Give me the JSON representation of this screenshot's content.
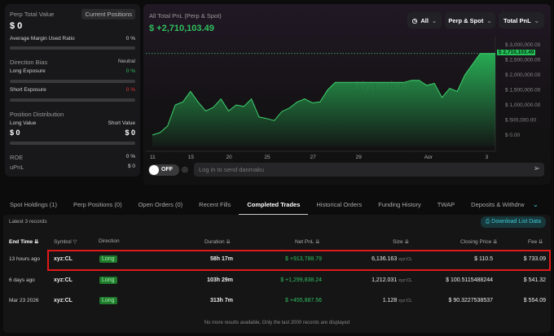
{
  "left": {
    "perp_total_value_label": "Perp Total Value",
    "current_positions_btn": "Current Positions",
    "perp_total_value": "$ 0",
    "margin_label": "Average Margin Used Ratio",
    "margin_value": "0 %",
    "margin_fill_pct": 0,
    "direction_bias_label": "Direction Bias",
    "direction_bias_value": "Neutral",
    "long_exposure_label": "Long Exposure",
    "long_exposure_value": "0 %",
    "short_exposure_label": "Short Exposure",
    "short_exposure_value": "0 %",
    "position_distribution_label": "Position Distribution",
    "long_value_label": "Long Value",
    "short_value_label": "Short Value",
    "long_value": "$ 0",
    "short_value": "$ 0",
    "roe_label": "ROE",
    "roe_value": "0 %",
    "upnl_label": "uPnL",
    "upnl_value": "$ 0"
  },
  "chart_header": {
    "title": "All Total PnL (Perp & Spot)",
    "value": "$ +2,710,103.49",
    "range": "All",
    "market": "Perp & Spot",
    "metric": "Total PnL",
    "watermark": "Hyperbot",
    "current_label": "$ 2,710,103.49"
  },
  "danmaku": {
    "toggle": "OFF",
    "placeholder": "Log in to send danmaku"
  },
  "chart_data": {
    "type": "area",
    "title": "All Total PnL (Perp & Spot)",
    "ylim": [
      -200000,
      3200000
    ],
    "yticks": [
      {
        "v": 3000000,
        "label": "$ 3,000,000.00"
      },
      {
        "v": 2500000,
        "label": "$ 2,500,000.00"
      },
      {
        "v": 2000000,
        "label": "$ 2,000,000.00"
      },
      {
        "v": 1500000,
        "label": "$ 1,500,000.00"
      },
      {
        "v": 1000000,
        "label": "$ 1,000,000.00"
      },
      {
        "v": 500000,
        "label": "$ 500,000.00"
      },
      {
        "v": 0,
        "label": "$ 0.00"
      }
    ],
    "xticks": [
      {
        "i": 0,
        "label": "11"
      },
      {
        "i": 5,
        "label": "15"
      },
      {
        "i": 10,
        "label": "20"
      },
      {
        "i": 15,
        "label": "25"
      },
      {
        "i": 21,
        "label": "27"
      },
      {
        "i": 27,
        "label": "29"
      },
      {
        "i": 36,
        "label": "Apr"
      },
      {
        "i": 44,
        "label": "3"
      }
    ],
    "values": [
      0,
      80000,
      300000,
      1000000,
      1100000,
      1450000,
      1100000,
      800000,
      920000,
      1200000,
      800000,
      1000000,
      950000,
      1200000,
      600000,
      550000,
      480000,
      780000,
      900000,
      1100000,
      1200000,
      1070000,
      1100000,
      1500000,
      1750000,
      1750000,
      1750000,
      1750000,
      1750000,
      1750000,
      1750000,
      1750000,
      1750000,
      1750000,
      1820000,
      1820000,
      1650000,
      1720000,
      1250000,
      1550000,
      1450000,
      2000000,
      2350000,
      2710103,
      2710103,
      2710103
    ]
  },
  "tabs": [
    "Spot Holdings (1)",
    "Perp Positions (0)",
    "Open Orders (0)",
    "Recent Fills",
    "Completed Trades",
    "Historical Orders",
    "Funding History",
    "TWAP",
    "Deposits & Withdrw"
  ],
  "table": {
    "records_label": "Latest 3 records",
    "download": "Download List Data",
    "headers": [
      "End Time",
      "Symbol",
      "Direction",
      "Duration",
      "Net PnL",
      "Size",
      "Closing Price",
      "Fee"
    ],
    "rows": [
      {
        "end": "13 hours ago",
        "symbol": "xyz:CL",
        "dir": "Long",
        "dur": "58h 17m",
        "pnl": "$ +913,788.79",
        "size": "6,136.163",
        "unit": "xyz:CL",
        "price": "$ 110.5",
        "fee": "$ 733.09"
      },
      {
        "end": "6 days ago",
        "symbol": "xyz:CL",
        "dir": "Long",
        "dur": "103h 29m",
        "pnl": "$ +1,299,838.24",
        "size": "1,212.031",
        "unit": "xyz:CL",
        "price": "$ 100.5115488244",
        "fee": "$ 541.32"
      },
      {
        "end": "Mar 23 2026",
        "symbol": "xyz:CL",
        "dir": "Long",
        "dur": "313h 7m",
        "pnl": "$ +455,887.56",
        "size": "1.128",
        "unit": "xyz:CL",
        "price": "$ 90.3227538537",
        "fee": "$ 554.09"
      }
    ],
    "footer": "No more results available, Only the last 2000 records are displayed"
  }
}
